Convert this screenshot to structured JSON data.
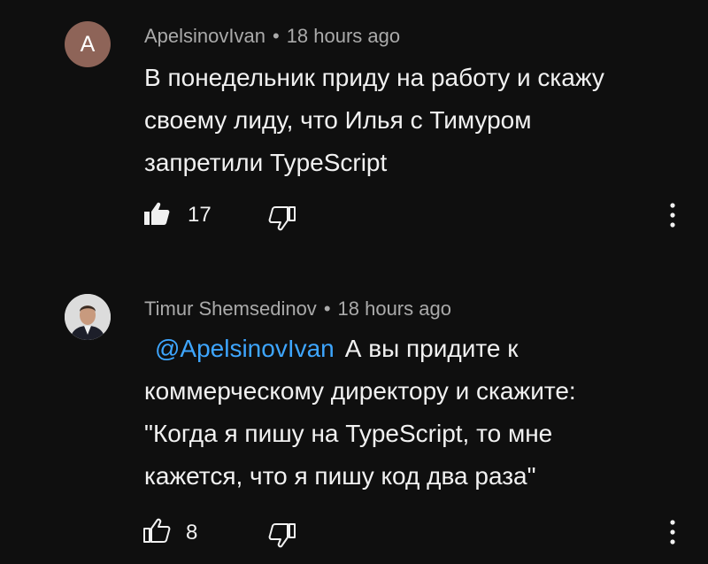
{
  "comments": [
    {
      "avatar_letter": "A",
      "author": "ApelsinovIvan",
      "separator": "•",
      "time": "18 hours ago",
      "mention": "",
      "lines": [
        "В понедельник приду на работу и скажу",
        "своему лиду, что Илья с Тимуром",
        "запретили TypeScript"
      ],
      "likes": "17",
      "liked": true
    },
    {
      "author": "Timur Shemsedinov",
      "separator": "•",
      "time": "18 hours ago",
      "mention": "@ApelsinovIvan",
      "lines": [
        "А вы придите к",
        "коммерческому директору и скажите:",
        "\"Когда я пишу на TypeScript, то мне",
        "кажется, что я пишу код два раза\""
      ],
      "likes": "8",
      "liked": false
    }
  ],
  "icons": {
    "like": "thumbs-up-icon",
    "dislike": "thumbs-down-icon",
    "more": "more-vertical-icon"
  },
  "colors": {
    "background": "#0f0f0f",
    "text": "#f1f1f1",
    "meta": "#aaaaaa",
    "mention": "#3ea6ff",
    "avatar": "#8e6458"
  }
}
